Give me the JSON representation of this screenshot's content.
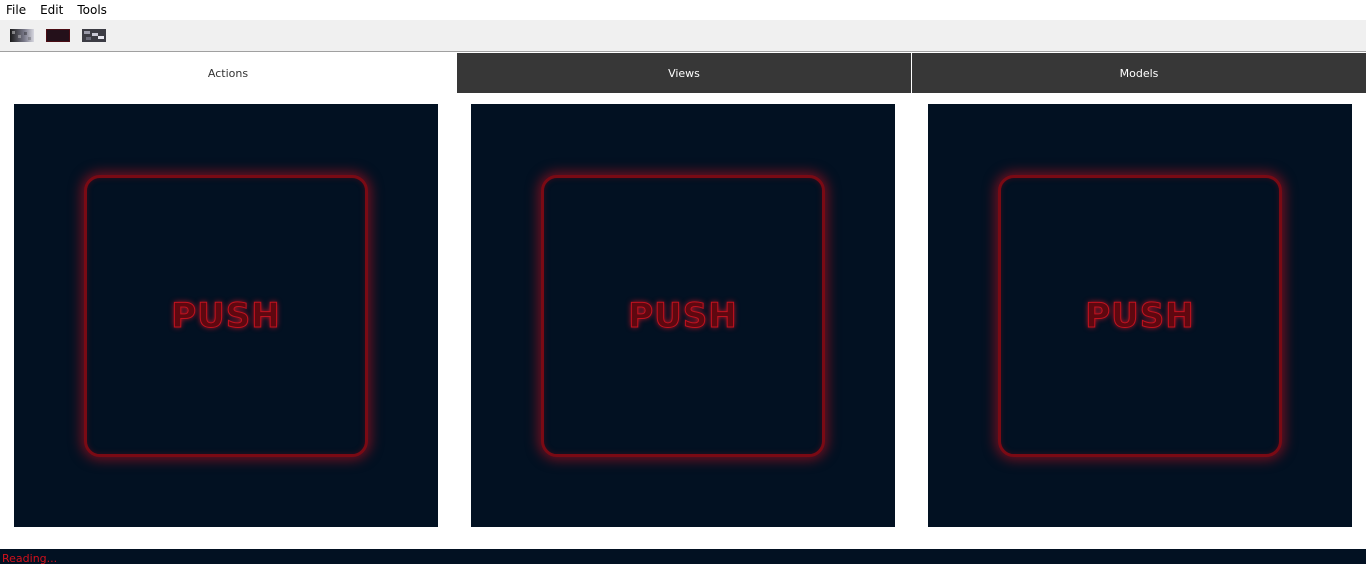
{
  "menu": [
    "File",
    "Edit",
    "Tools"
  ],
  "toolbar": {
    "icons": [
      "gradient-grey-icon",
      "dark-red-swatch-icon",
      "grey-pattern-icon"
    ]
  },
  "tabs": [
    {
      "label": "Actions",
      "active": true
    },
    {
      "label": "Views",
      "active": false
    },
    {
      "label": "Models",
      "active": false
    }
  ],
  "panels": [
    {
      "button_label": "PUSH"
    },
    {
      "button_label": "PUSH"
    },
    {
      "button_label": "PUSH"
    }
  ],
  "status": {
    "text": "Reading..."
  },
  "colors": {
    "panel_bg": "#021122",
    "glow": "#c0121f",
    "tab_inactive": "#373737",
    "status_text": "#d4101c"
  }
}
